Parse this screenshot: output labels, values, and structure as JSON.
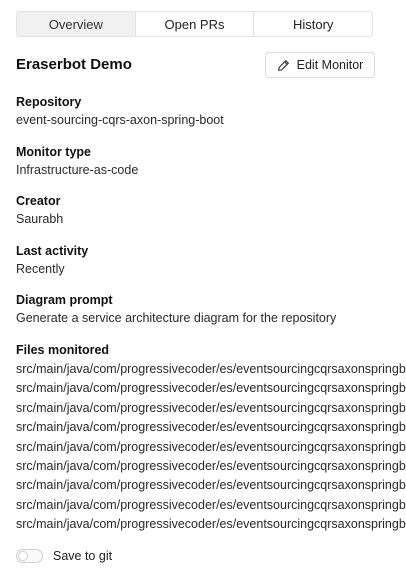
{
  "tabs": [
    {
      "label": "Overview",
      "active": true
    },
    {
      "label": "Open PRs",
      "active": false
    },
    {
      "label": "History",
      "active": false
    }
  ],
  "monitor": {
    "name": "Eraserbot Demo",
    "edit_label": "Edit Monitor",
    "edit_icon": "pencil-icon"
  },
  "fields": {
    "repository": {
      "label": "Repository",
      "value": "event-sourcing-cqrs-axon-spring-boot"
    },
    "monitor_type": {
      "label": "Monitor type",
      "value": "Infrastructure-as-code"
    },
    "creator": {
      "label": "Creator",
      "value": "Saurabh"
    },
    "last_activity": {
      "label": "Last activity",
      "value": "Recently"
    },
    "diagram_prompt": {
      "label": "Diagram prompt",
      "value": "Generate a service architecture diagram for the repository"
    }
  },
  "files_monitored": {
    "label": "Files monitored",
    "files": [
      "src/main/java/com/progressivecoder/es/eventsourcingcqrsaxonspringb",
      "src/main/java/com/progressivecoder/es/eventsourcingcqrsaxonspringb",
      "src/main/java/com/progressivecoder/es/eventsourcingcqrsaxonspringb",
      "src/main/java/com/progressivecoder/es/eventsourcingcqrsaxonspringb",
      "src/main/java/com/progressivecoder/es/eventsourcingcqrsaxonspringb",
      "src/main/java/com/progressivecoder/es/eventsourcingcqrsaxonspringb",
      "src/main/java/com/progressivecoder/es/eventsourcingcqrsaxonspringb",
      "src/main/java/com/progressivecoder/es/eventsourcingcqrsaxonspringb",
      "src/main/java/com/progressivecoder/es/eventsourcingcqrsaxonspringb"
    ]
  },
  "save_to_git": {
    "label": "Save to git",
    "enabled": false
  }
}
